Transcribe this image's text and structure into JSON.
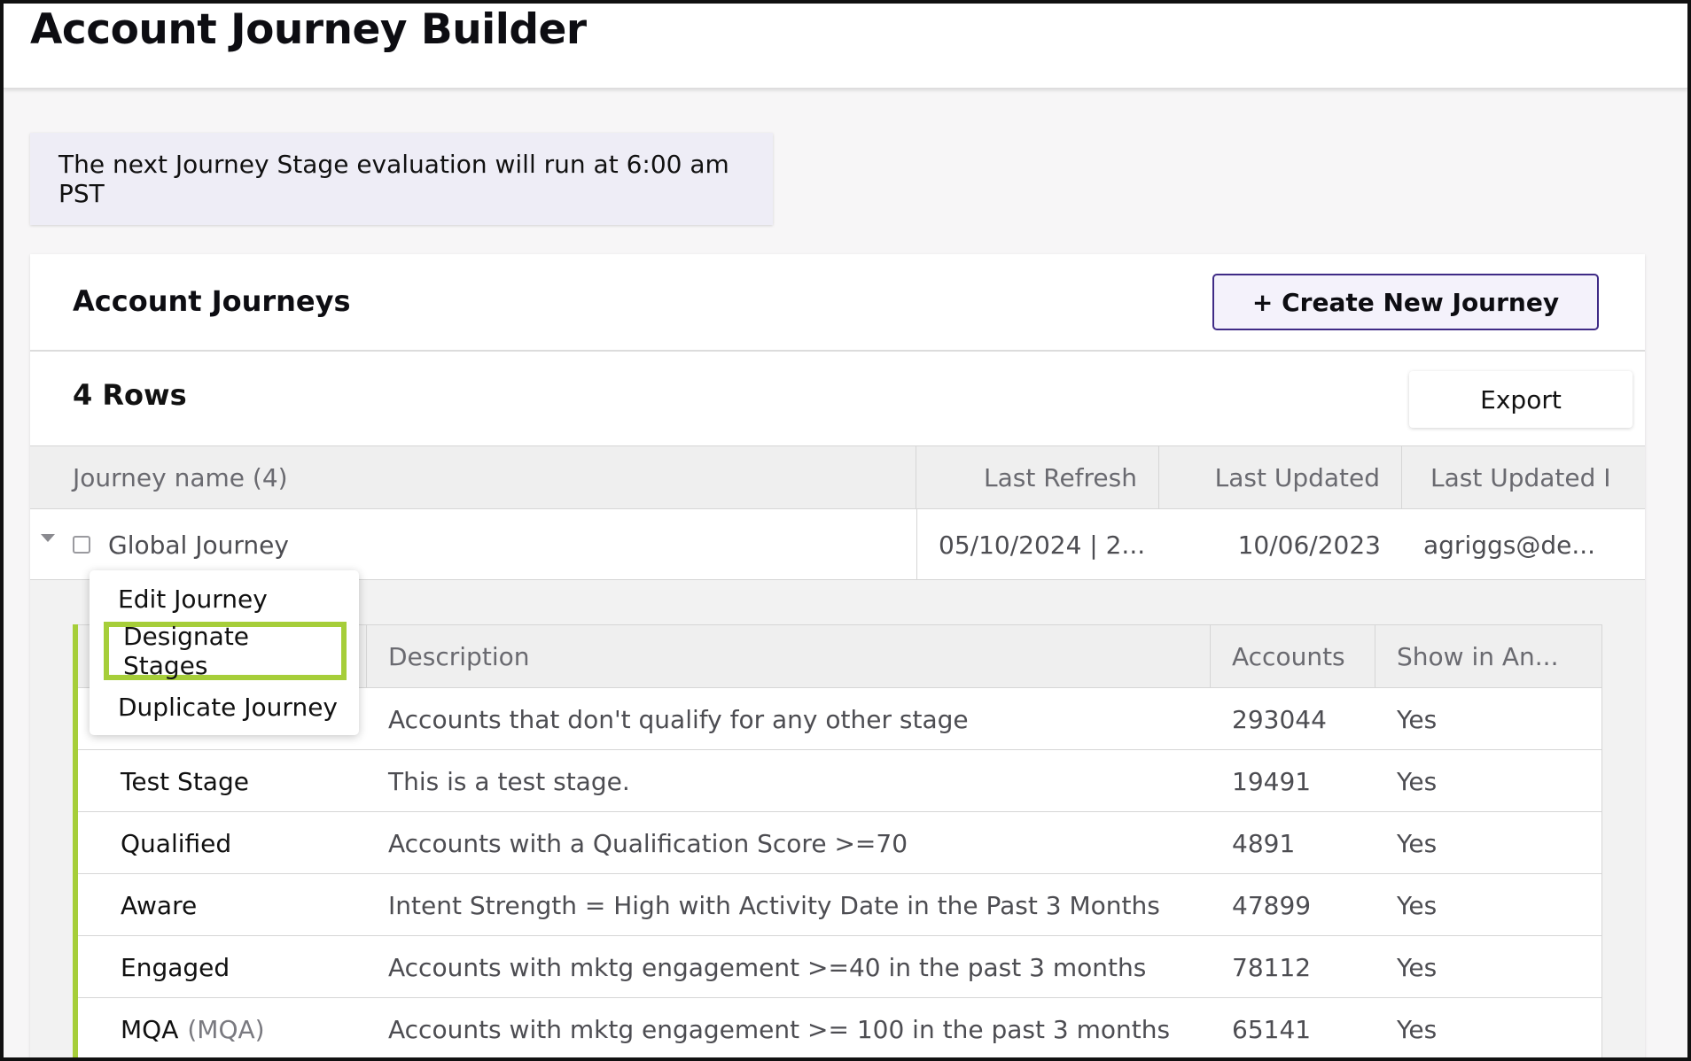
{
  "header": {
    "title": "Account Journey Builder"
  },
  "notice": {
    "text": "The next Journey Stage evaluation will run at 6:00 am PST"
  },
  "card": {
    "title": "Account Journeys",
    "create_button": "+ Create New Journey",
    "row_count": "4 Rows",
    "export_button": "Export"
  },
  "grid": {
    "columns": [
      "Journey name (4)",
      "Last Refresh",
      "Last Updated",
      "Last Updated I"
    ],
    "row": {
      "name": "Global Journey",
      "last_refresh": "05/10/2024 | 2...",
      "last_updated": "10/06/2023",
      "last_updated_by": "agriggs@de..."
    }
  },
  "context_menu": {
    "items": [
      "Edit Journey",
      "Designate Stages",
      "Duplicate Journey"
    ],
    "highlighted": "Designate Stages",
    "highlight_color": "#a6ce39"
  },
  "stages": {
    "columns": [
      "Description",
      "Accounts",
      "Show in An..."
    ],
    "rows": [
      {
        "name": "",
        "abbr": "",
        "description": "Accounts that don't qualify for any other stage",
        "accounts": "293044",
        "show": "Yes"
      },
      {
        "name": "Test Stage",
        "abbr": "",
        "description": "This is a test stage.",
        "accounts": "19491",
        "show": "Yes"
      },
      {
        "name": "Qualified",
        "abbr": "",
        "description": "Accounts with a Qualification Score >=70",
        "accounts": "4891",
        "show": "Yes"
      },
      {
        "name": "Aware",
        "abbr": "",
        "description": "Intent Strength = High with Activity Date in the Past 3 Months",
        "accounts": "47899",
        "show": "Yes"
      },
      {
        "name": "Engaged",
        "abbr": "",
        "description": "Accounts with mktg engagement >=40 in the past 3 months",
        "accounts": "78112",
        "show": "Yes"
      },
      {
        "name": "MQA",
        "abbr": "(MQA)",
        "description": "Accounts with mktg engagement >= 100 in the past 3 months",
        "accounts": "65141",
        "show": "Yes"
      }
    ]
  }
}
